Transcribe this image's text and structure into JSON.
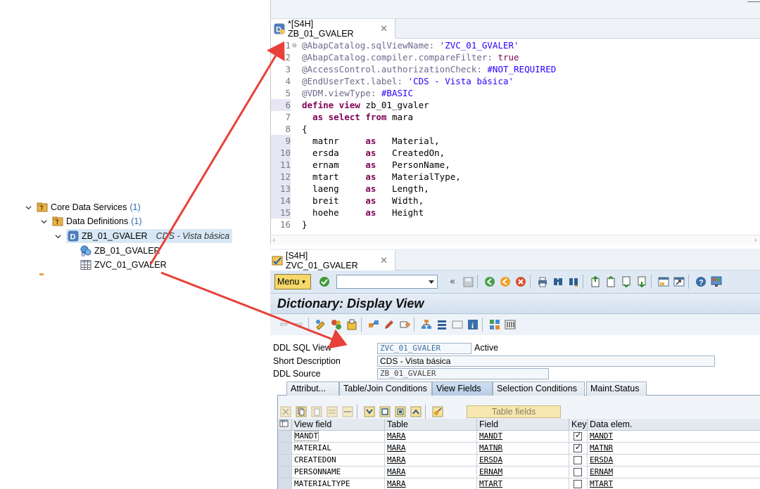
{
  "tree": {
    "core": {
      "label": "Core Data Services",
      "count": "(1)"
    },
    "defs": {
      "label": "Data Definitions",
      "count": "(1)"
    },
    "zb": {
      "label": "ZB_01_GVALER",
      "desc": "CDS - Vista básica"
    },
    "zb_child": {
      "label": "ZB_01_GVALER"
    },
    "zvc_child": {
      "label": "ZVC_01_GVALER"
    }
  },
  "editor": {
    "tab_title": "*[S4H] ZB_01_GVALER",
    "lines": [
      {
        "n": "1",
        "t": "@AbapCatalog.sqlViewName: 'ZVC_01_GVALER'"
      },
      {
        "n": "2",
        "t": "@AbapCatalog.compiler.compareFilter: true"
      },
      {
        "n": "3",
        "t": "@AccessControl.authorizationCheck: #NOT_REQUIRED"
      },
      {
        "n": "4",
        "t": "@EndUserText.label: 'CDS - Vista básica'"
      },
      {
        "n": "5",
        "t": "@VDM.viewType: #BASIC"
      },
      {
        "n": "6",
        "t": "define view zb_01_gvaler"
      },
      {
        "n": "7",
        "t": "  as select from mara"
      },
      {
        "n": "8",
        "t": "{"
      },
      {
        "n": "9",
        "t": "  matnr     as   Material,"
      },
      {
        "n": "10",
        "t": "  ersda     as   CreatedOn,"
      },
      {
        "n": "11",
        "t": "  ernam     as   PersonName,"
      },
      {
        "n": "12",
        "t": "  mtart     as   MaterialType,"
      },
      {
        "n": "13",
        "t": "  laeng     as   Length,"
      },
      {
        "n": "14",
        "t": "  breit     as   Width,"
      },
      {
        "n": "15",
        "t": "  hoehe     as   Height"
      },
      {
        "n": "16",
        "t": "}"
      }
    ]
  },
  "sap": {
    "tab_title": "[S4H] ZVC_01_GVALER",
    "menu_label": "Menu",
    "title": "Dictionary: Display View",
    "fields": {
      "ddl_sql_view_label": "DDL SQL View",
      "ddl_sql_view_value": "ZVC_01_GVALER",
      "status": "Active",
      "short_desc_label": "Short Description",
      "short_desc_value": "CDS - Vista básica",
      "ddl_source_label": "DDL Source",
      "ddl_source_value": "ZB_01_GVALER"
    },
    "tabs": [
      "Attribut...",
      "Table/Join Conditions",
      "View Fields",
      "Selection Conditions",
      "Maint.Status"
    ],
    "table_fields_btn": "Table fields",
    "columns": [
      "View field",
      "Table",
      "Field",
      "Key",
      "Data elem."
    ],
    "rows": [
      {
        "view_field": "MANDT",
        "table": "MARA",
        "field": "MANDT",
        "key": true,
        "data_elem": "MANDT"
      },
      {
        "view_field": "MATERIAL",
        "table": "MARA",
        "field": "MATNR",
        "key": true,
        "data_elem": "MATNR"
      },
      {
        "view_field": "CREATEDON",
        "table": "MARA",
        "field": "ERSDA",
        "key": false,
        "data_elem": "ERSDA"
      },
      {
        "view_field": "PERSONNAME",
        "table": "MARA",
        "field": "ERNAM",
        "key": false,
        "data_elem": "ERNAM"
      },
      {
        "view_field": "MATERIALTYPE",
        "table": "MARA",
        "field": "MTART",
        "key": false,
        "data_elem": "MTART"
      }
    ]
  },
  "colors": {
    "arrow": "#e8413a",
    "accent": "#2a6cb0"
  }
}
